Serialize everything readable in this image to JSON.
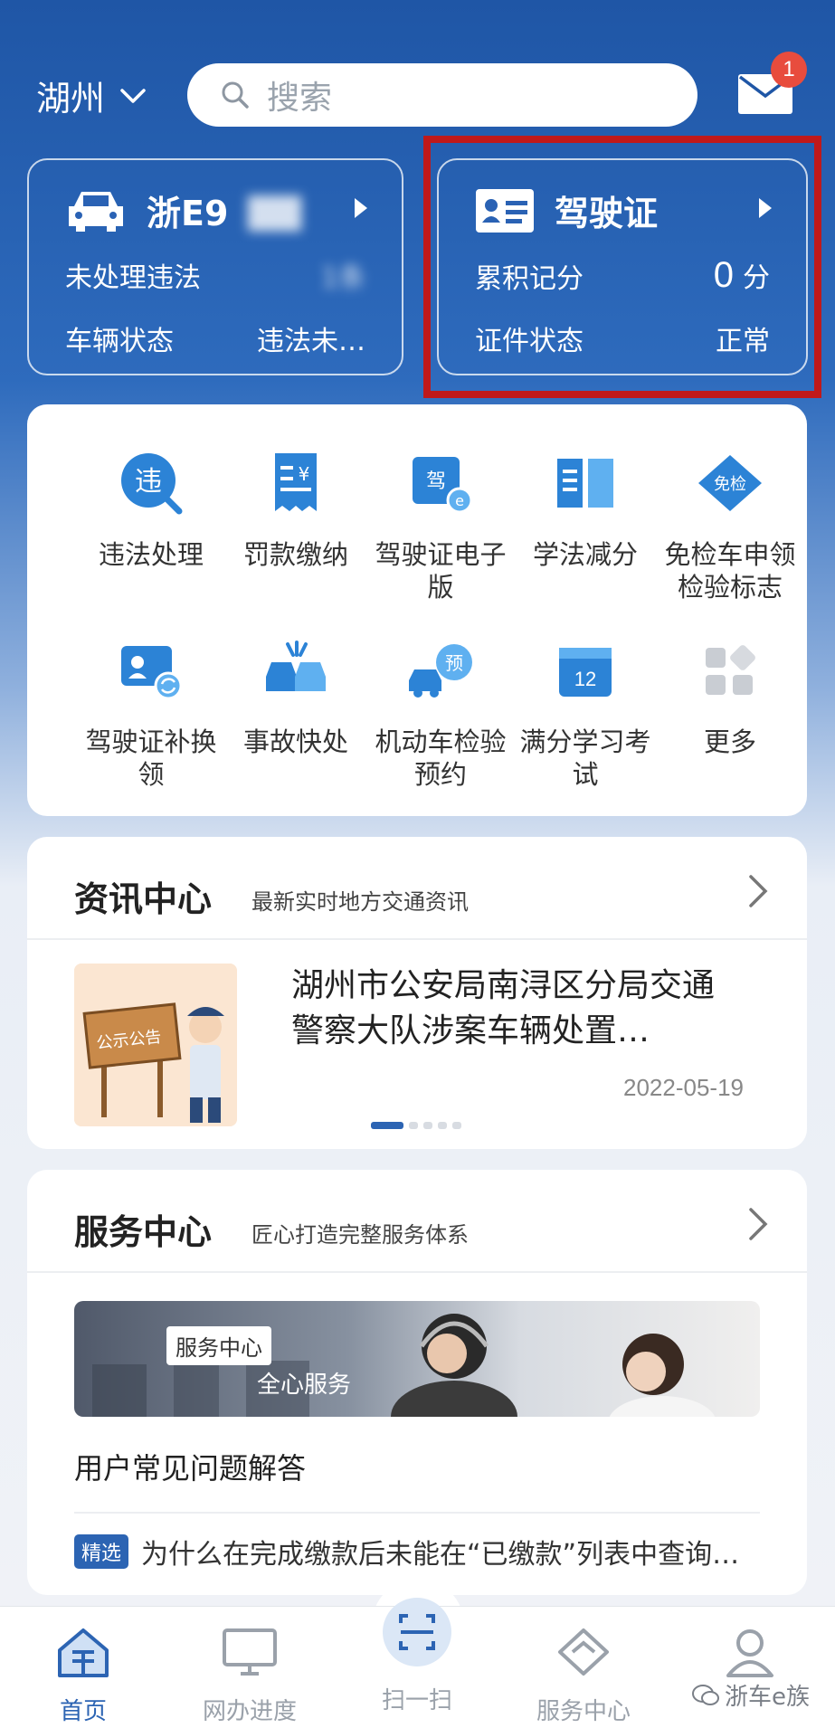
{
  "header": {
    "city": "湖州",
    "search_placeholder": "搜索",
    "mail_badge": "1"
  },
  "vehicle_card": {
    "plate": "浙E9",
    "row1_label": "未处理违法",
    "row1_value": "1条",
    "row2_label": "车辆状态",
    "row2_value": "违法未…"
  },
  "license_card": {
    "title": "驾驶证",
    "row1_label": "累积记分",
    "row1_value": "0",
    "row1_unit": "分",
    "row2_label": "证件状态",
    "row2_value": "正常"
  },
  "services": [
    {
      "label": "违法处理",
      "icon": "violation-icon"
    },
    {
      "label": "罚款缴纳",
      "icon": "fine-payment-icon"
    },
    {
      "label": "驾驶证电子版",
      "icon": "e-license-icon"
    },
    {
      "label": "学法减分",
      "icon": "study-book-icon"
    },
    {
      "label": "免检车申领检验标志",
      "icon": "exempt-inspection-icon"
    },
    {
      "label": "驾驶证补换领",
      "icon": "license-renew-icon"
    },
    {
      "label": "事故快处",
      "icon": "accident-icon"
    },
    {
      "label": "机动车检验预约",
      "icon": "inspection-booking-icon",
      "badge": "预"
    },
    {
      "label": "满分学习考试",
      "icon": "calendar-exam-icon",
      "badge": "12"
    },
    {
      "label": "更多",
      "icon": "more-grid-icon"
    }
  ],
  "icon_badges": {
    "violation": "违",
    "fine": "¥",
    "license": "驾",
    "exempt": "免检"
  },
  "news": {
    "title": "资讯中心",
    "subtitle": "最新实时地方交通资讯",
    "headline": "湖州市公安局南浔区分局交通警察大队涉案车辆处置…",
    "date": "2022-05-19",
    "image_sign": "公示公告"
  },
  "service_center": {
    "title": "服务中心",
    "subtitle": "匠心打造完整服务体系",
    "banner_tag": "服务中心",
    "banner_text": "全心服务",
    "faq_title": "用户常见问题解答",
    "faq_tag": "精选",
    "faq_item": "为什么在完成缴款后未能在“已缴款”列表中查询…"
  },
  "tabs": [
    {
      "label": "首页",
      "icon": "home-icon",
      "active": true
    },
    {
      "label": "网办进度",
      "icon": "monitor-icon",
      "active": false
    },
    {
      "label": "扫一扫",
      "icon": "scan-icon",
      "active": false
    },
    {
      "label": "服务中心",
      "icon": "service-diamond-icon",
      "active": false
    },
    {
      "label": "",
      "icon": "user-icon",
      "active": false
    }
  ],
  "watermark": "浙车e族",
  "colors": {
    "primary_blue": "#2c64b3",
    "header_blue": "#1f56a6",
    "highlight_red": "#c0191a",
    "badge_red": "#e84c3d"
  }
}
